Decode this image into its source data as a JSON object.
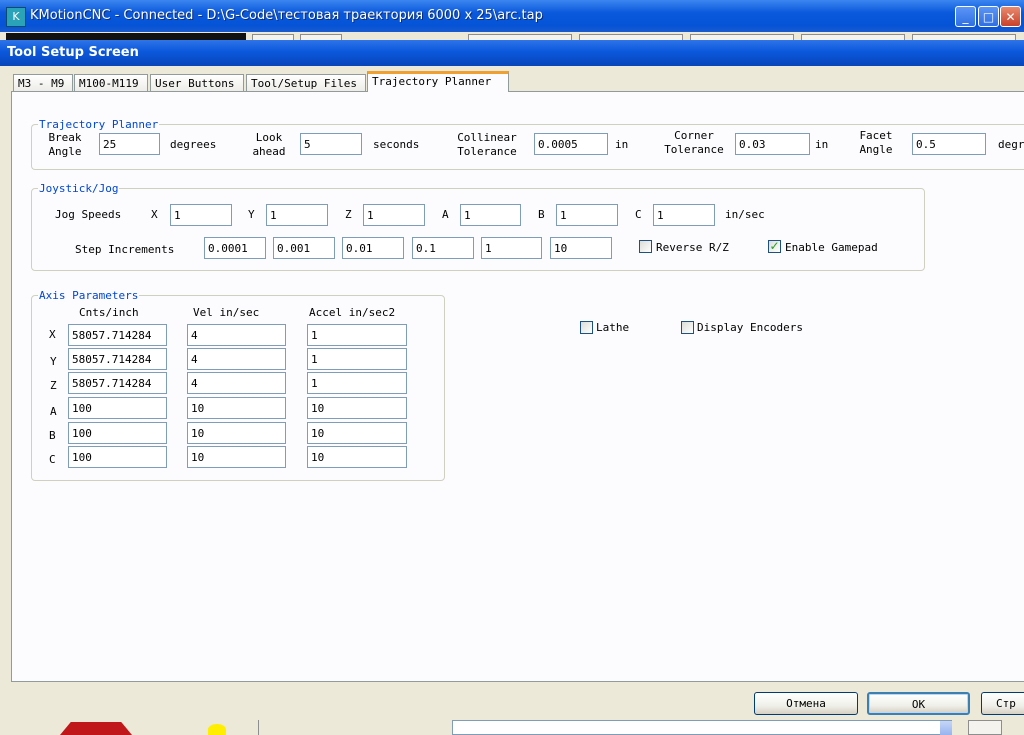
{
  "main_window": {
    "title": "KMotionCNC - Connected - D:\\G-Code\\тестовая траектория 6000 x 25\\arc.tap",
    "app_icon": "kmotion-app-icon",
    "minimize": "_",
    "maximize": "□",
    "close": "✕"
  },
  "dialog": {
    "title": "Tool Setup Screen",
    "tabs": [
      {
        "label": "M3 - M9"
      },
      {
        "label": "M100-M119"
      },
      {
        "label": "User Buttons"
      },
      {
        "label": "Tool/Setup Files"
      },
      {
        "label": "Trajectory Planner"
      }
    ],
    "trajectory": {
      "title": "Trajectory Planner",
      "break_angle_label_1": "Break",
      "break_angle_label_2": "Angle",
      "break_angle_value": "25",
      "break_angle_unit": "degrees",
      "lookahead_label_1": "Look",
      "lookahead_label_2": "ahead",
      "lookahead_value": "5",
      "lookahead_unit": "seconds",
      "collinear_label_1": "Collinear",
      "collinear_label_2": "Tolerance",
      "collinear_value": "0.0005",
      "collinear_unit": "in",
      "corner_label_1": "Corner",
      "corner_label_2": "Tolerance",
      "corner_value": "0.03",
      "corner_unit": "in",
      "facet_label_1": "Facet",
      "facet_label_2": "Angle",
      "facet_value": "0.5",
      "facet_unit": "degrees"
    },
    "joystick": {
      "title": "Joystick/Jog",
      "jog_speeds_label": "Jog Speeds",
      "jog_axes": [
        {
          "axis": "X",
          "value": "1"
        },
        {
          "axis": "Y",
          "value": "1"
        },
        {
          "axis": "Z",
          "value": "1"
        },
        {
          "axis": "A",
          "value": "1"
        },
        {
          "axis": "B",
          "value": "1"
        },
        {
          "axis": "C",
          "value": "1"
        }
      ],
      "jog_unit": "in/sec",
      "step_label": "Step Increments",
      "steps": [
        "0.0001",
        "0.001",
        "0.01",
        "0.1",
        "1",
        "10"
      ],
      "reverse_rz_label": "Reverse R/Z",
      "reverse_rz_checked": false,
      "gamepad_label": "Enable Gamepad",
      "gamepad_checked": true
    },
    "axis_params": {
      "title": "Axis Parameters",
      "headers": [
        "Cnts/inch",
        "Vel in/sec",
        "Accel in/sec2"
      ],
      "rows": [
        {
          "axis": "X",
          "cnts": "58057.714284",
          "vel": "4",
          "accel": "1"
        },
        {
          "axis": "Y",
          "cnts": "58057.714284",
          "vel": "4",
          "accel": "1"
        },
        {
          "axis": "Z",
          "cnts": "58057.714284",
          "vel": "4",
          "accel": "1"
        },
        {
          "axis": "A",
          "cnts": "100",
          "vel": "10",
          "accel": "10"
        },
        {
          "axis": "B",
          "cnts": "100",
          "vel": "10",
          "accel": "10"
        },
        {
          "axis": "C",
          "cnts": "100",
          "vel": "10",
          "accel": "10"
        }
      ]
    },
    "lathe_label": "Lathe",
    "lathe_checked": false,
    "display_encoders_label": "Display Encoders",
    "display_encoders_checked": false,
    "cancel_label": "Отмена",
    "ok_label": "OK",
    "apply_label": "Стр"
  },
  "colors": {
    "titlebar": "#0a58dc",
    "group_title": "#0046d5",
    "active_tab_accent": "#f0a030",
    "checkmark": "#21a121"
  }
}
